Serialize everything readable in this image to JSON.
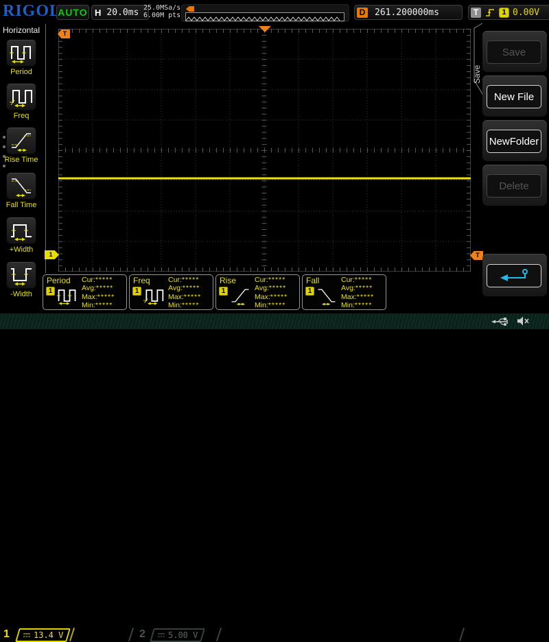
{
  "colors": {
    "accent_yellow": "#e6e000",
    "accent_orange": "#f08018",
    "logo_blue": "#1d5fc4",
    "auto_green": "#11c811",
    "back_arrow_cyan": "#22b8e8"
  },
  "top_bar": {
    "logo": "RIGOL",
    "acquisition_status": "AUTO",
    "horizontal_label": "H",
    "horizontal_scale": "20.0ms",
    "sample_rate": "25.0MSa/s",
    "memory_depth": "6.00M pts",
    "delay_label": "D",
    "delay_value": "261.200000ms",
    "trigger_label": "T",
    "trigger_channel": "1",
    "trigger_level": "0.00V"
  },
  "left_sidebar": {
    "title": "Horizontal",
    "items": [
      {
        "label": "Period",
        "icon": "period-icon"
      },
      {
        "label": "Freq",
        "icon": "freq-icon"
      },
      {
        "label": "Rise Time",
        "icon": "rise-time-icon"
      },
      {
        "label": "Fall Time",
        "icon": "fall-time-icon"
      },
      {
        "label": "+Width",
        "icon": "plus-width-icon"
      },
      {
        "label": "-Width",
        "icon": "minus-width-icon"
      }
    ]
  },
  "grid": {
    "trigger_position_marker": "T",
    "trigger_level_marker": "T",
    "channel_marker": "1"
  },
  "right_menu": {
    "tab_label": "Save",
    "buttons": [
      {
        "label": "Save",
        "enabled": false
      },
      {
        "label": "New File",
        "enabled": true
      },
      {
        "label": "NewFolder",
        "enabled": true
      },
      {
        "label": "Delete",
        "enabled": false
      }
    ],
    "back_button_icon": "return-arrow-icon"
  },
  "measurement_labels": {
    "cur": "Cur:",
    "avg": "Avg:",
    "max": "Max:",
    "min": "Min:"
  },
  "measurements": [
    {
      "name": "Period",
      "channel": "1",
      "cur": "*****",
      "avg": "*****",
      "max": "*****",
      "min": "*****"
    },
    {
      "name": "Freq",
      "channel": "1",
      "cur": "*****",
      "avg": "*****",
      "max": "*****",
      "min": "*****"
    },
    {
      "name": "Rise",
      "channel": "1",
      "cur": "*****",
      "avg": "*****",
      "max": "*****",
      "min": "*****"
    },
    {
      "name": "Fall",
      "channel": "1",
      "cur": "*****",
      "avg": "*****",
      "max": "*****",
      "min": "*****"
    }
  ],
  "bottom_bar": {
    "channels": [
      {
        "number": "1",
        "scale": "13.4 V",
        "active": true
      },
      {
        "number": "2",
        "scale": "5.00 V",
        "active": false
      }
    ],
    "status_icons": [
      "usb-icon",
      "speaker-muted-icon"
    ]
  }
}
